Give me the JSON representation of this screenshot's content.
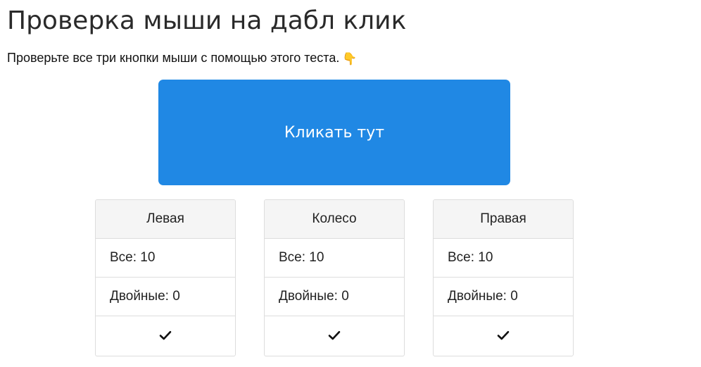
{
  "header": {
    "title": "Проверка мыши на дабл клик",
    "subtitle": "Проверьте все три кнопки мыши с помощью этого теста.",
    "subtitle_icon": "pointing-down-hand-icon"
  },
  "click_area": {
    "label": "Кликать тут",
    "color": "#2088e4"
  },
  "buttons": [
    {
      "name": "Левая",
      "all_label": "Все: 10",
      "double_label": "Двойные: 0",
      "status_icon": "checkmark-icon"
    },
    {
      "name": "Колесо",
      "all_label": "Все: 10",
      "double_label": "Двойные: 0",
      "status_icon": "checkmark-icon"
    },
    {
      "name": "Правая",
      "all_label": "Все: 10",
      "double_label": "Двойные: 0",
      "status_icon": "checkmark-icon"
    }
  ]
}
